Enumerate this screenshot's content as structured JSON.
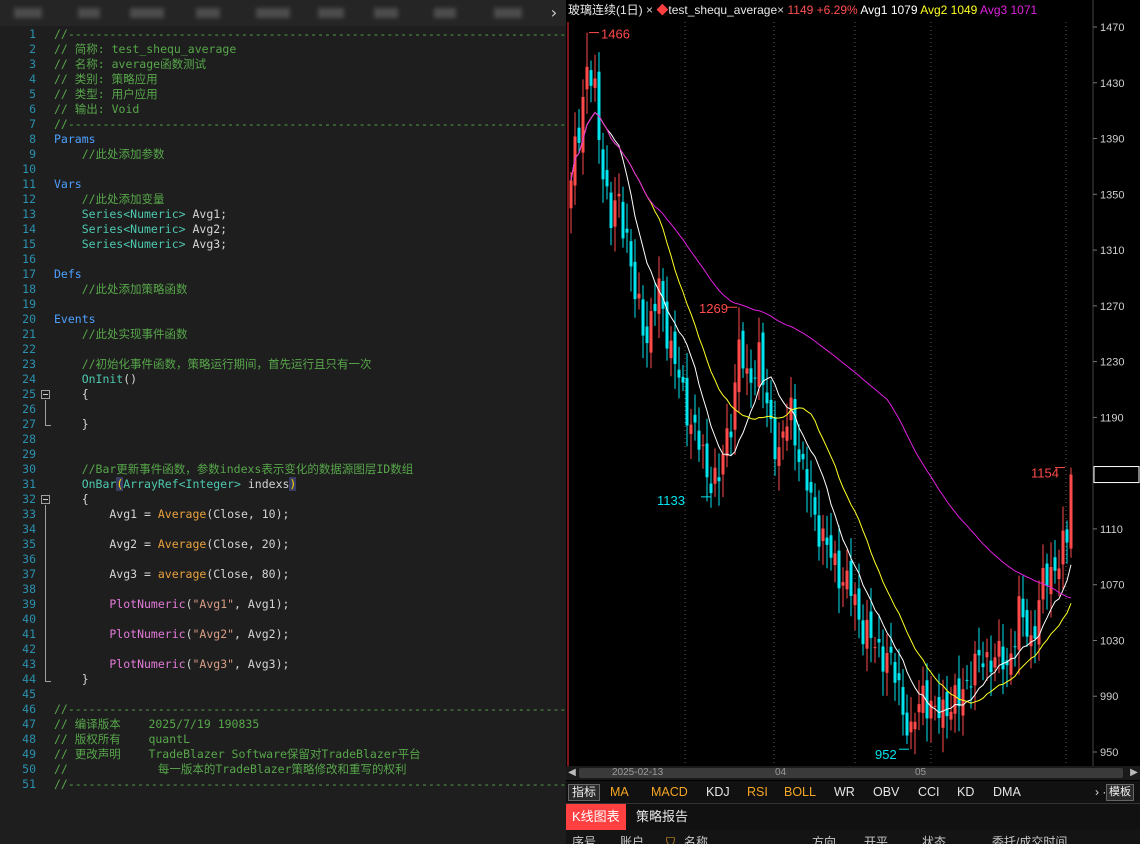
{
  "editor": {
    "lines": [
      {
        "n": "1",
        "parts": [
          {
            "t": "//-----------------------------------------------------------------------------------",
            "c": "cm"
          }
        ]
      },
      {
        "n": "2",
        "parts": [
          {
            "t": "// 简称: test_shequ_average",
            "c": "cm"
          }
        ]
      },
      {
        "n": "3",
        "parts": [
          {
            "t": "// 名称: average函数测试",
            "c": "cm"
          }
        ]
      },
      {
        "n": "4",
        "parts": [
          {
            "t": "// 类别: 策略应用",
            "c": "cm"
          }
        ]
      },
      {
        "n": "5",
        "parts": [
          {
            "t": "// 类型: 用户应用",
            "c": "cm"
          }
        ]
      },
      {
        "n": "6",
        "parts": [
          {
            "t": "// 输出: Void",
            "c": "cm"
          }
        ]
      },
      {
        "n": "7",
        "parts": [
          {
            "t": "//-----------------------------------------------------------------------------------",
            "c": "cm"
          }
        ]
      },
      {
        "n": "8",
        "parts": [
          {
            "t": "Params",
            "c": "kw"
          }
        ]
      },
      {
        "n": "9",
        "parts": [
          {
            "t": "    //此处添加参数",
            "c": "cm"
          }
        ]
      },
      {
        "n": "10",
        "parts": []
      },
      {
        "n": "11",
        "parts": [
          {
            "t": "Vars",
            "c": "kw"
          }
        ]
      },
      {
        "n": "12",
        "parts": [
          {
            "t": "    //此处添加变量",
            "c": "cm"
          }
        ]
      },
      {
        "n": "13",
        "parts": [
          {
            "t": "    Series<Numeric>",
            "c": "ty"
          },
          {
            "t": " Avg1;",
            "c": ""
          }
        ]
      },
      {
        "n": "14",
        "parts": [
          {
            "t": "    Series<Numeric>",
            "c": "ty"
          },
          {
            "t": " Avg2;",
            "c": ""
          }
        ]
      },
      {
        "n": "15",
        "parts": [
          {
            "t": "    Series<Numeric>",
            "c": "ty"
          },
          {
            "t": " Avg3;",
            "c": ""
          }
        ]
      },
      {
        "n": "16",
        "parts": []
      },
      {
        "n": "17",
        "parts": [
          {
            "t": "Defs",
            "c": "kw"
          }
        ]
      },
      {
        "n": "18",
        "parts": [
          {
            "t": "    //此处添加策略函数",
            "c": "cm"
          }
        ]
      },
      {
        "n": "19",
        "parts": []
      },
      {
        "n": "20",
        "parts": [
          {
            "t": "Events",
            "c": "kw"
          }
        ]
      },
      {
        "n": "21",
        "parts": [
          {
            "t": "    //此处实现事件函数",
            "c": "cm"
          }
        ]
      },
      {
        "n": "22",
        "parts": []
      },
      {
        "n": "23",
        "parts": [
          {
            "t": "    //初始化事件函数，策略运行期间，首先运行且只有一次",
            "c": "cm"
          }
        ]
      },
      {
        "n": "24",
        "parts": [
          {
            "t": "    OnInit",
            "c": "ty"
          },
          {
            "t": "()",
            "c": ""
          }
        ]
      },
      {
        "n": "25",
        "parts": [
          {
            "t": "    {",
            "c": ""
          }
        ]
      },
      {
        "n": "26",
        "parts": []
      },
      {
        "n": "27",
        "parts": [
          {
            "t": "    }",
            "c": ""
          }
        ]
      },
      {
        "n": "28",
        "parts": []
      },
      {
        "n": "29",
        "parts": []
      },
      {
        "n": "30",
        "parts": [
          {
            "t": "    //Bar更新事件函数，参数indexs表示变化的数据源图层ID数组",
            "c": "cm"
          }
        ]
      },
      {
        "n": "31",
        "parts": [
          {
            "t": "    OnBar",
            "c": "ty"
          },
          {
            "t": "(",
            "c": "br"
          },
          {
            "t": "ArrayRef<Integer>",
            "c": "ty"
          },
          {
            "t": " indexs",
            "c": ""
          },
          {
            "t": ")",
            "c": "br"
          }
        ]
      },
      {
        "n": "32",
        "parts": [
          {
            "t": "    {",
            "c": ""
          }
        ]
      },
      {
        "n": "33",
        "parts": [
          {
            "t": "        Avg1 = ",
            "c": ""
          },
          {
            "t": "Average",
            "c": "fn"
          },
          {
            "t": "(Close, 10);",
            "c": ""
          }
        ]
      },
      {
        "n": "34",
        "parts": []
      },
      {
        "n": "35",
        "parts": [
          {
            "t": "        Avg2 = ",
            "c": ""
          },
          {
            "t": "Average",
            "c": "fn"
          },
          {
            "t": "(Close, 20);",
            "c": ""
          }
        ]
      },
      {
        "n": "36",
        "parts": []
      },
      {
        "n": "37",
        "parts": [
          {
            "t": "        Avg3 = ",
            "c": ""
          },
          {
            "t": "average",
            "c": "fn"
          },
          {
            "t": "(Close, 80);",
            "c": ""
          }
        ]
      },
      {
        "n": "38",
        "parts": []
      },
      {
        "n": "39",
        "parts": [
          {
            "t": "        PlotNumeric",
            "c": "pl"
          },
          {
            "t": "(",
            "c": ""
          },
          {
            "t": "\"Avg1\"",
            "c": "st"
          },
          {
            "t": ", Avg1);",
            "c": ""
          }
        ]
      },
      {
        "n": "40",
        "parts": []
      },
      {
        "n": "41",
        "parts": [
          {
            "t": "        PlotNumeric",
            "c": "pl"
          },
          {
            "t": "(",
            "c": ""
          },
          {
            "t": "\"Avg2\"",
            "c": "st"
          },
          {
            "t": ", Avg2);",
            "c": ""
          }
        ]
      },
      {
        "n": "42",
        "parts": []
      },
      {
        "n": "43",
        "parts": [
          {
            "t": "        PlotNumeric",
            "c": "pl"
          },
          {
            "t": "(",
            "c": ""
          },
          {
            "t": "\"Avg3\"",
            "c": "st"
          },
          {
            "t": ", Avg3);",
            "c": ""
          }
        ]
      },
      {
        "n": "44",
        "parts": [
          {
            "t": "    }",
            "c": ""
          }
        ]
      },
      {
        "n": "45",
        "parts": []
      },
      {
        "n": "46",
        "parts": [
          {
            "t": "//-----------------------------------------------------------------------------------",
            "c": "cm"
          }
        ]
      },
      {
        "n": "47",
        "parts": [
          {
            "t": "// 编译版本    2025/7/19 190835",
            "c": "cm"
          }
        ]
      },
      {
        "n": "48",
        "parts": [
          {
            "t": "// 版权所有    quantL",
            "c": "cm"
          }
        ]
      },
      {
        "n": "49",
        "parts": [
          {
            "t": "// 更改声明    TradeBlazer Software保留对TradeBlazer平台",
            "c": "cm"
          }
        ]
      },
      {
        "n": "50",
        "parts": [
          {
            "t": "//             每一版本的TradeBlazer策略修改和重写的权利",
            "c": "cm"
          }
        ]
      },
      {
        "n": "51",
        "parts": [
          {
            "t": "//-----------------------------------------------------------------------------------",
            "c": "cm"
          }
        ]
      }
    ]
  },
  "chart": {
    "title": {
      "symbol": "玻璃连续(1日)",
      "close_icon": "×",
      "strategy_marker": "◆",
      "strategy": "test_shequ_average",
      "strategy_close": "×",
      "price": "1149 +6.29%",
      "avg1_label": "Avg1 1079",
      "avg2_label": "Avg2 1049",
      "avg3_label": "Avg3 1071"
    },
    "colors": {
      "up": "#ff4a4a",
      "down": "#00e5ee",
      "avg1": "#ffffff",
      "avg2": "#ffff22",
      "avg3": "#e020e0",
      "axis": "#cfcfcf",
      "accent_red": "#ff4040"
    },
    "axis_ticks": [
      "1470",
      "1430",
      "1390",
      "1350",
      "1310",
      "1270",
      "1230",
      "1190",
      "1149",
      "1110",
      "1070",
      "1030",
      "990",
      "950"
    ],
    "dates": [
      "2025-02-13",
      "04",
      "05"
    ],
    "annotations": [
      {
        "text": "1466",
        "kind": "high"
      },
      {
        "text": "1269",
        "kind": "high"
      },
      {
        "text": "1133",
        "kind": "low"
      },
      {
        "text": "952",
        "kind": "low"
      },
      {
        "text": "1154",
        "kind": "high"
      }
    ],
    "indicators": {
      "label": "指标",
      "items": [
        "MA",
        "MACD",
        "KDJ",
        "RSI",
        "BOLL",
        "WR",
        "OBV",
        "CCI",
        "KD",
        "DMA"
      ],
      "more": "› ···",
      "template": "模板"
    },
    "report_tabs": [
      "K线图表",
      "策略报告"
    ],
    "report_header": [
      "序号",
      "账户",
      "名称",
      "方向",
      "开平",
      "状态",
      "委托/成交时间"
    ]
  },
  "chart_data": {
    "type": "candlestick",
    "price_axis": {
      "min": 950,
      "max": 1470,
      "ticks": [
        1470,
        1430,
        1390,
        1350,
        1310,
        1270,
        1230,
        1190,
        1149,
        1110,
        1070,
        1030,
        990,
        950
      ]
    },
    "bars_count": 140,
    "key_points": [
      {
        "label": "1466",
        "value": 1466,
        "bar": 4
      },
      {
        "label": "1269",
        "value": 1269,
        "bar": 42
      },
      {
        "label": "1133",
        "value": 1133,
        "bar": 36
      },
      {
        "label": "952",
        "value": 952,
        "bar": 85
      },
      {
        "label": "1154",
        "value": 1154,
        "bar": 124
      }
    ],
    "close_anchors": [
      [
        0,
        1365
      ],
      [
        2,
        1400
      ],
      [
        4,
        1440
      ],
      [
        6,
        1420
      ],
      [
        8,
        1370
      ],
      [
        10,
        1330
      ],
      [
        12,
        1345
      ],
      [
        14,
        1320
      ],
      [
        16,
        1275
      ],
      [
        19,
        1250
      ],
      [
        22,
        1280
      ],
      [
        25,
        1240
      ],
      [
        28,
        1205
      ],
      [
        31,
        1180
      ],
      [
        34,
        1150
      ],
      [
        37,
        1145
      ],
      [
        40,
        1190
      ],
      [
        42,
        1240
      ],
      [
        44,
        1215
      ],
      [
        47,
        1235
      ],
      [
        49,
        1195
      ],
      [
        52,
        1165
      ],
      [
        55,
        1195
      ],
      [
        58,
        1150
      ],
      [
        61,
        1120
      ],
      [
        64,
        1095
      ],
      [
        67,
        1080
      ],
      [
        70,
        1065
      ],
      [
        73,
        1040
      ],
      [
        76,
        1025
      ],
      [
        79,
        1020
      ],
      [
        82,
        995
      ],
      [
        85,
        960
      ],
      [
        88,
        995
      ],
      [
        91,
        975
      ],
      [
        94,
        985
      ],
      [
        97,
        985
      ],
      [
        100,
        1010
      ],
      [
        103,
        1015
      ],
      [
        106,
        1020
      ],
      [
        109,
        1010
      ],
      [
        112,
        1050
      ],
      [
        115,
        1030
      ],
      [
        118,
        1070
      ],
      [
        121,
        1085
      ],
      [
        124,
        1100
      ],
      [
        125,
        1149
      ]
    ],
    "series": [
      {
        "name": "Avg1",
        "period": 10,
        "last": 1079
      },
      {
        "name": "Avg2",
        "period": 20,
        "last": 1049
      },
      {
        "name": "Avg3",
        "period": 80,
        "last": 1071
      }
    ]
  }
}
